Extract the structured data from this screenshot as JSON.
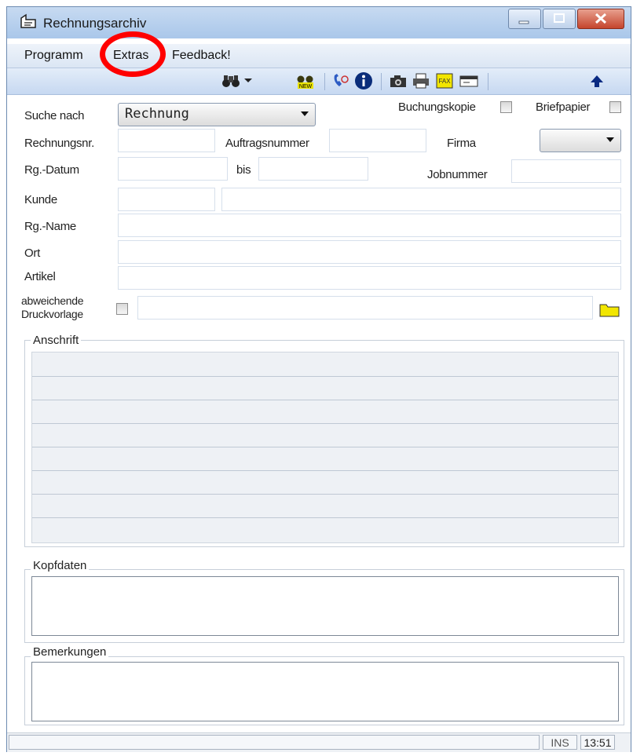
{
  "window": {
    "title": "Rechnungsarchiv"
  },
  "menu": {
    "items": [
      "Programm",
      "Extras",
      "Feedback!"
    ]
  },
  "toolbar": {
    "icons": [
      "binoculars-icon",
      "dropdown-arrow-icon",
      "new-search-icon",
      "phone-icon",
      "info-icon",
      "camera-icon",
      "printer-icon",
      "fax-icon",
      "email-icon",
      "up-arrow-icon"
    ]
  },
  "form": {
    "search_label": "Suche nach",
    "search_value": "Rechnung",
    "buchungskopie_label": "Buchungskopie",
    "briefpapier_label": "Briefpapier",
    "rechnungsnr_label": "Rechnungsnr.",
    "auftragsnummer_label": "Auftragsnummer",
    "firma_label": "Firma",
    "rg_datum_label": "Rg.-Datum",
    "bis_label": "bis",
    "jobnummer_label": "Jobnummer",
    "kunde_label": "Kunde",
    "rg_name_label": "Rg.-Name",
    "ort_label": "Ort",
    "artikel_label": "Artikel",
    "abweichende_label": "abweichende",
    "druckvorlage_label": "Druckvorlage"
  },
  "groups": {
    "anschrift": "Anschrift",
    "kopfdaten": "Kopfdaten",
    "bemerkungen": "Bemerkungen"
  },
  "status": {
    "mode": "INS",
    "time": "13:51"
  },
  "colors": {
    "annotation": "#ff0000",
    "titlebar": "#b5cdee",
    "close_button": "#c5452d"
  }
}
